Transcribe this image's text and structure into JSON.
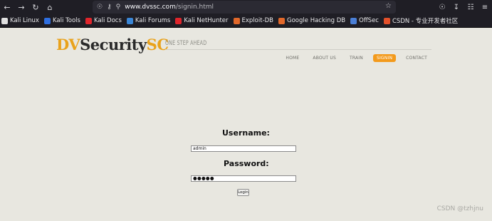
{
  "browser": {
    "url_host": "www.dvssc.com",
    "url_path": "/signin.html",
    "bookmarks": [
      {
        "label": "Kali Linux",
        "color": "#e0e0e0"
      },
      {
        "label": "Kali Tools",
        "color": "#2f6fe0"
      },
      {
        "label": "Kali Docs",
        "color": "#e0252b"
      },
      {
        "label": "Kali Forums",
        "color": "#3a86d6"
      },
      {
        "label": "Kali NetHunter",
        "color": "#e0252b"
      },
      {
        "label": "Exploit-DB",
        "color": "#e1682a"
      },
      {
        "label": "Google Hacking DB",
        "color": "#e1682a"
      },
      {
        "label": "OffSec",
        "color": "#4a7fd6"
      },
      {
        "label": "CSDN - 专业开发者社区",
        "color": "#e3502a"
      }
    ]
  },
  "site": {
    "logo_part1": "DV",
    "logo_part2": "Security",
    "logo_part3": "SC",
    "tagline": "ONE STEP AHEAD",
    "menu": [
      "HOME",
      "ABOUT US",
      "TRAIN",
      "SIGNIN",
      "CONTACT"
    ],
    "active_menu": "SIGNIN"
  },
  "form": {
    "username_label": "Username:",
    "username_value": "admin",
    "password_label": "Password:",
    "password_value": "●●●●●",
    "login_label": "Login"
  },
  "watermark": "CSDN @tzhjnu",
  "colors": {
    "accent": "#f39a1c",
    "logo_gold": "#e9a21b",
    "page_bg": "#e8e7e0"
  }
}
